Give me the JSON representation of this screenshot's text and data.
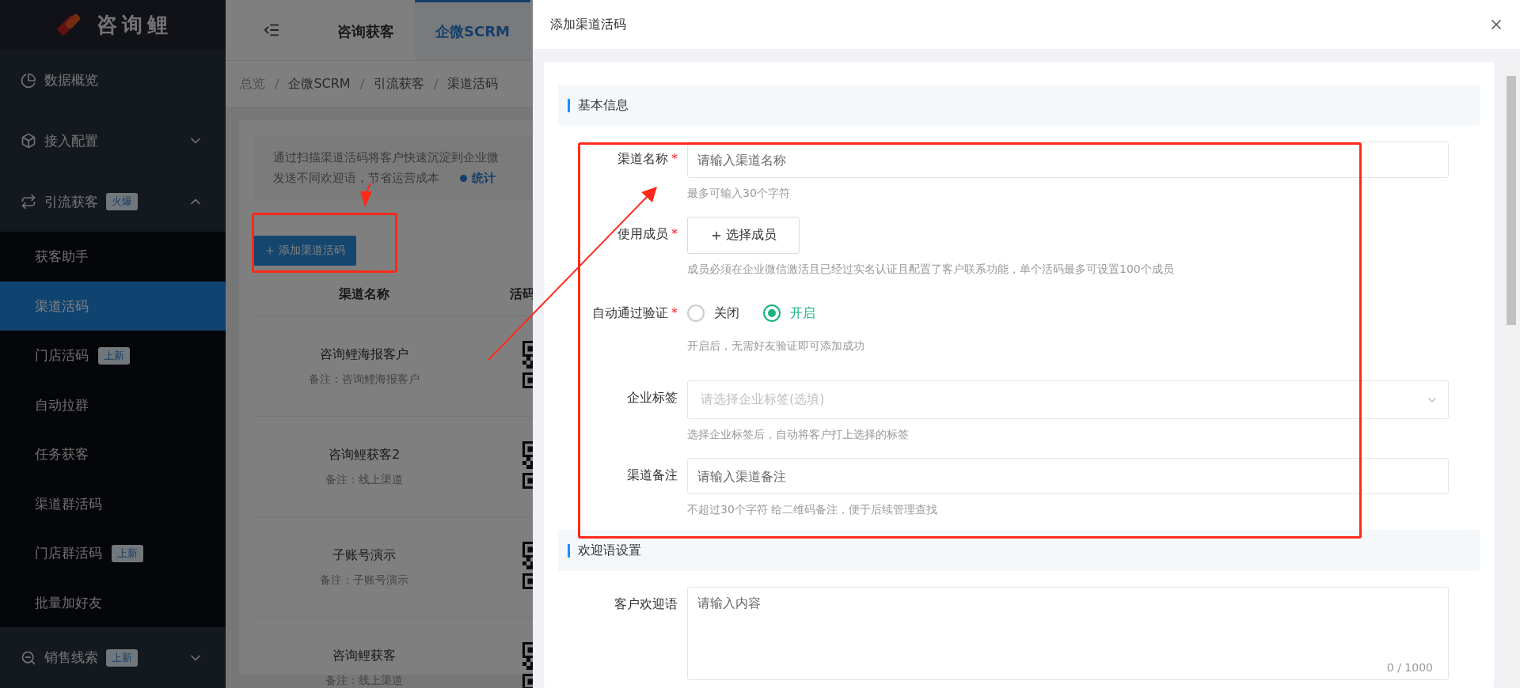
{
  "sidebar": {
    "logo": "咨询鲤",
    "items": [
      {
        "label": "数据概览",
        "selected": false
      },
      {
        "label": "接入配置",
        "selected": false,
        "expanded": false
      },
      {
        "label": "引流获客",
        "badge": "火爆",
        "selected": false,
        "expanded": true,
        "children": [
          {
            "label": "获客助手",
            "selected": false
          },
          {
            "label": "渠道活码",
            "selected": true
          },
          {
            "label": "门店活码",
            "badge": "上新",
            "selected": false
          },
          {
            "label": "自动拉群",
            "selected": false
          },
          {
            "label": "任务获客",
            "selected": false
          },
          {
            "label": "渠道群活码",
            "selected": false
          },
          {
            "label": "门店群活码",
            "badge": "上新",
            "selected": false
          },
          {
            "label": "批量加好友",
            "selected": false
          }
        ]
      },
      {
        "label": "销售线索",
        "badge": "上新",
        "selected": false,
        "expanded": false
      }
    ]
  },
  "header": {
    "tabs": [
      {
        "label": "咨询获客",
        "selected": false
      },
      {
        "label": "企微SCRM",
        "selected": true
      }
    ]
  },
  "breadcrumb": {
    "items": [
      "总览",
      "企微SCRM",
      "引流获客",
      "渠道活码"
    ],
    "separator": "/"
  },
  "description": {
    "lines": [
      "通过扫描渠道活码将客户快速沉淀到企业微",
      "发送不同欢迎语，节省运营成本"
    ],
    "link": "统计"
  },
  "add_button": "添加渠道活码",
  "table": {
    "columns": [
      "渠道名称",
      "活码"
    ],
    "rows": [
      {
        "name": "咨询鲤海报客户",
        "note": "备注：咨询鲤海报客户"
      },
      {
        "name": "咨询鲤获客2",
        "note": "备注：线上渠道"
      },
      {
        "name": "子账号演示",
        "note": "备注：子账号演示"
      },
      {
        "name": "咨询鲤获客",
        "note": "备注：线上渠道"
      }
    ]
  },
  "drawer": {
    "title": "添加渠道活码",
    "sections": [
      {
        "title": "基本信息",
        "fields": [
          {
            "kind": "input",
            "label": "渠道名称",
            "required_mark": "*",
            "placeholder": "请输入渠道名称",
            "hint": "最多可输入30个字符"
          },
          {
            "kind": "member",
            "label": "使用成员",
            "required_mark": "*",
            "button": "选择成员",
            "hint": "成员必须在企业微信激活且已经过实名认证且配置了客户联系功能，单个活码最多可设置100个成员"
          },
          {
            "kind": "radio",
            "label": "自动通过验证",
            "required_mark": "*",
            "options": [
              {
                "label": "关闭",
                "selected": false
              },
              {
                "label": "开启",
                "selected": true
              }
            ],
            "hint": "开启后，无需好友验证即可添加成功"
          },
          {
            "kind": "select",
            "label": "企业标签",
            "placeholder": "请选择企业标签(选填)",
            "hint": "选择企业标签后，自动将客户打上选择的标签"
          },
          {
            "kind": "input",
            "label": "渠道备注",
            "placeholder": "请输入渠道备注",
            "hint": "不超过30个字符 给二维码备注，便于后续管理查找"
          }
        ]
      },
      {
        "title": "欢迎语设置",
        "fields": [
          {
            "kind": "textarea",
            "label": "客户欢迎语",
            "placeholder": "请输入内容",
            "counter": "0 / 1000"
          }
        ]
      }
    ]
  }
}
